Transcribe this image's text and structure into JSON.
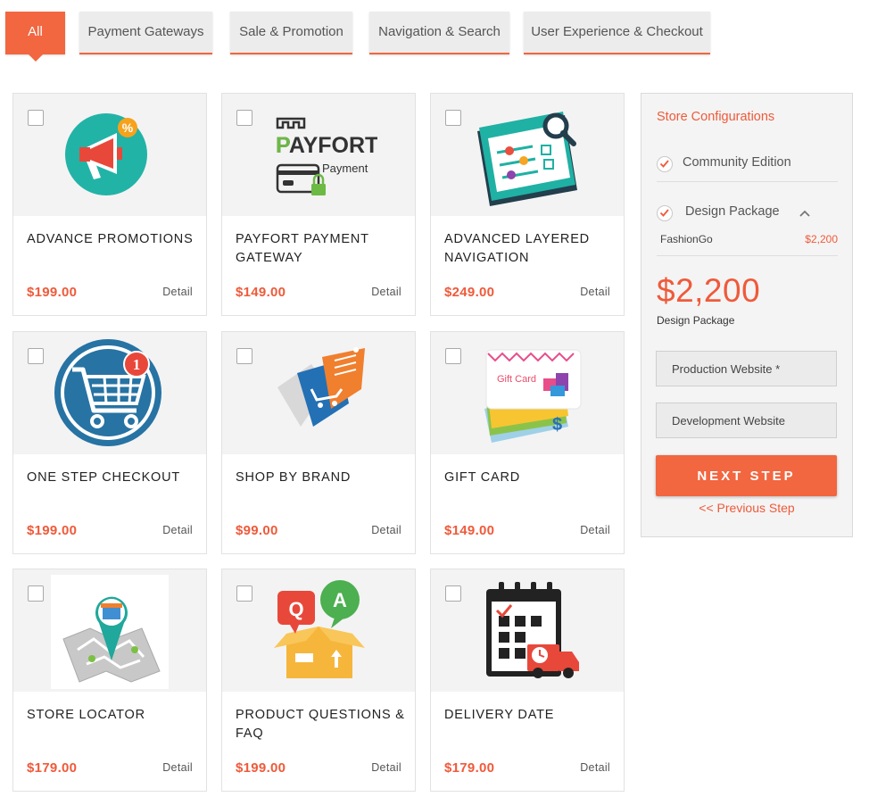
{
  "tabs": [
    {
      "label": "All",
      "active": true
    },
    {
      "label": "Payment Gateways",
      "active": false
    },
    {
      "label": "Sale & Promotion",
      "active": false
    },
    {
      "label": "Navigation & Search",
      "active": false
    },
    {
      "label": "User Experience & Checkout",
      "active": false
    }
  ],
  "products": [
    {
      "title": "ADVANCE PROMOTIONS",
      "price": "$199.00",
      "detail": "Detail",
      "icon": "megaphone-icon"
    },
    {
      "title": "PAYFORT PAYMENT GATEWAY",
      "price": "$149.00",
      "detail": "Detail",
      "icon": "payfort-logo-icon",
      "logo_text": "PAYFORT",
      "logo_sub": "Payment"
    },
    {
      "title": "ADVANCED LAYERED NAVIGATION",
      "price": "$249.00",
      "detail": "Detail",
      "icon": "filter-panel-icon"
    },
    {
      "title": "ONE STEP CHECKOUT",
      "price": "$199.00",
      "detail": "Detail",
      "icon": "shopping-cart-icon",
      "badge": "1"
    },
    {
      "title": "SHOP BY BRAND",
      "price": "$99.00",
      "detail": "Detail",
      "icon": "brand-tags-icon"
    },
    {
      "title": "GIFT CARD",
      "price": "$149.00",
      "detail": "Detail",
      "icon": "gift-card-icon",
      "card_text": "Gift Card"
    },
    {
      "title": "STORE LOCATOR",
      "price": "$179.00",
      "detail": "Detail",
      "icon": "map-pin-icon"
    },
    {
      "title": "PRODUCT QUESTIONS & FAQ",
      "price": "$199.00",
      "detail": "Detail",
      "icon": "qa-box-icon",
      "q": "Q",
      "a": "A"
    },
    {
      "title": "DELIVERY DATE",
      "price": "$179.00",
      "detail": "Detail",
      "icon": "calendar-truck-icon"
    }
  ],
  "sidebar": {
    "title": "Store Configurations",
    "edition": "Community Edition",
    "package": "Design Package",
    "package_item": "FashionGo",
    "package_item_price": "$2,200",
    "total": "$2,200",
    "total_label": "Design Package",
    "production_placeholder": "Production Website *",
    "development_placeholder": "Development Website",
    "next_label": "NEXT STEP",
    "prev_label": "<< Previous Step"
  },
  "colors": {
    "accent": "#f26640",
    "price": "#ef5a3a",
    "tab_bg": "#ececec"
  }
}
